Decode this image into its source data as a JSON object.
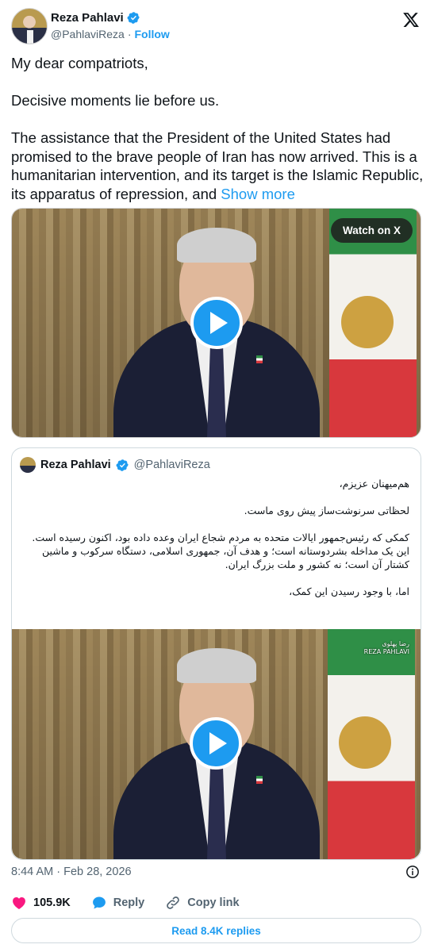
{
  "author": {
    "name": "Reza Pahlavi",
    "handle": "@PahlaviReza",
    "separator": "·",
    "follow_label": "Follow"
  },
  "post": {
    "paragraphs": [
      "My dear compatriots,",
      "Decisive moments lie before us.",
      "The assistance that the President of the United States had promised to the brave people of Iran has now arrived. This is a humanitarian intervention, and its target is the Islamic Republic, its apparatus of repression, and"
    ],
    "show_more_label": "Show more"
  },
  "video": {
    "watch_label": "Watch on X"
  },
  "quoted_post": {
    "name": "Reza Pahlavi",
    "handle": "@PahlaviReza",
    "paragraphs": [
      "هم‌میهنان عزیزم،",
      "لحظاتی سرنوشت‌ساز پیش روی ماست.",
      "کمکی که رئیس‌جمهور ایالات متحده به مردم شجاع ایران وعده داده بود، اکنون رسیده است. این یک مداخله بشردوستانه است؛ و هدف آن، جمهوری اسلامی، دستگاه سرکوب و ماشین کشتار آن است؛ نه کشور و ملت بزرگ ایران.",
      "اما، با وجود رسیدن این کمک،"
    ],
    "video_brand_fa": "رضا پهلوی",
    "video_brand_en": "REZA PAHLAVI"
  },
  "meta": {
    "time": "8:44 AM",
    "separator": "·",
    "date": "Feb 28, 2026"
  },
  "actions": {
    "like_count": "105.9K",
    "reply_label": "Reply",
    "copy_link_label": "Copy link"
  },
  "read_replies_label": "Read 8.4K replies",
  "icons": {
    "verified": "verified-badge-icon",
    "brand": "x-logo-icon",
    "like": "heart-icon",
    "reply": "speech-bubble-icon",
    "copy": "link-icon",
    "info": "info-icon"
  },
  "colors": {
    "accent": "#1d9bf0",
    "like": "#f91880",
    "text": "#0f1419",
    "muted": "#536471",
    "border": "#cfd9de"
  }
}
